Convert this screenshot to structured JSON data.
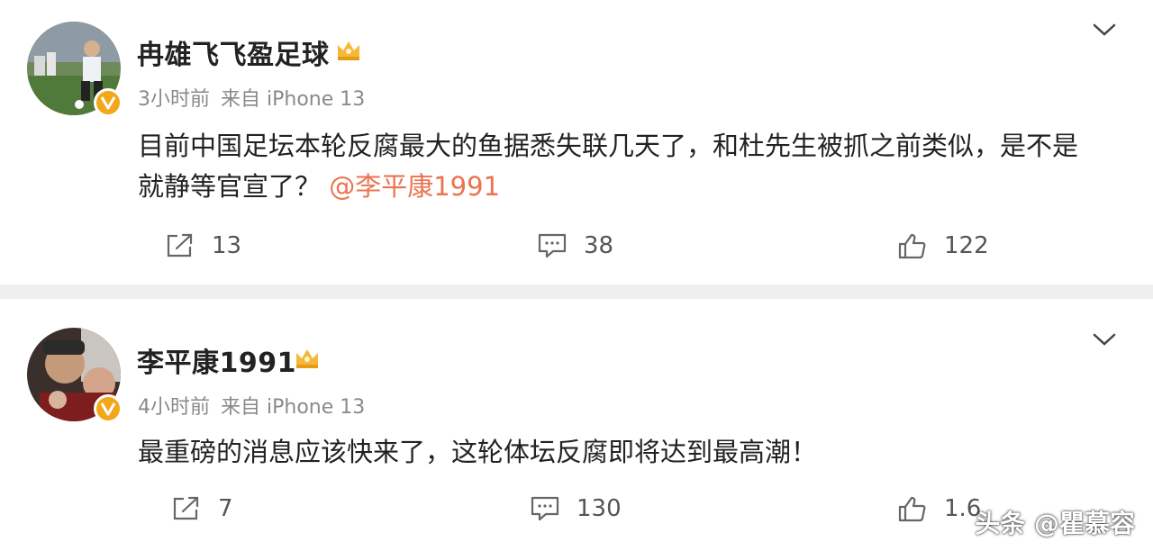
{
  "posts": [
    {
      "name": "冉雄飞飞盈足球",
      "time": "3小时前",
      "source": "来自 iPhone 13",
      "text": "目前中国足坛本轮反腐最大的鱼据悉失联几天了，和杜先生被抓之前类似，是不是",
      "text2": "就静等官宣了？",
      "mention": "@李平康1991",
      "reposts": "13",
      "comments": "38",
      "likes": "122"
    },
    {
      "name": "李平康1991",
      "time": "4小时前",
      "source": "来自 iPhone 13",
      "text": "最重磅的消息应该快来了，这轮体坛反腐即将达到最高潮！",
      "reposts": "7",
      "comments": "130",
      "likes": "1.6"
    }
  ],
  "watermark": "头条 @瞿慕容",
  "colors": {
    "mention": "#eb7350",
    "badge": "#f3a81b",
    "separator": "#efeff1"
  },
  "icons": [
    "crown-icon",
    "verified-badge-icon",
    "chevron-down-icon",
    "repost-icon",
    "comment-icon",
    "like-icon"
  ]
}
